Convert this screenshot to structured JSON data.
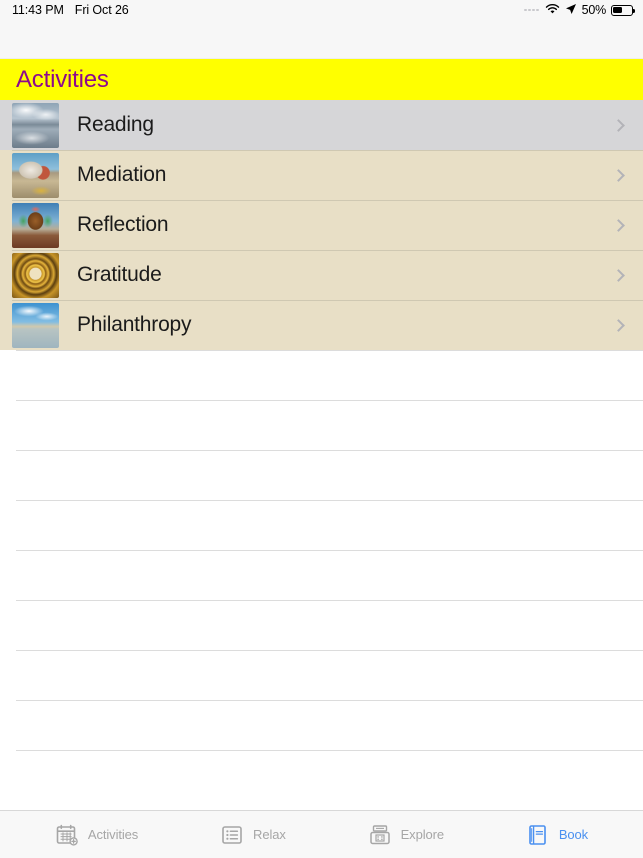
{
  "status_bar": {
    "time": "11:43 PM",
    "date": "Fri Oct 26",
    "signal_icon": "signal-dots-icon",
    "wifi_icon": "wifi-icon",
    "location_icon": "location-arrow-icon",
    "battery_percent": "50%",
    "battery_icon": "battery-icon",
    "battery_level": 50
  },
  "section": {
    "title": "Activities",
    "header_background": "#ffff00",
    "header_text_color": "#8d0a8d"
  },
  "list": {
    "background": "#e8dfc6",
    "selected_background": "#d6d6d8",
    "rows": [
      {
        "label": "Reading",
        "thumb": "lake-reflection-thumbnail",
        "art": "art-lake-reflection",
        "selected": true,
        "accessory": "chevron-right-icon"
      },
      {
        "label": "Mediation",
        "thumb": "shore-camp-thumbnail",
        "art": "art-shore-camp",
        "selected": false,
        "accessory": "chevron-right-icon"
      },
      {
        "label": "Reflection",
        "thumb": "ornate-urn-thumbnail",
        "art": "art-urn",
        "selected": false,
        "accessory": "chevron-right-icon"
      },
      {
        "label": "Gratitude",
        "thumb": "golden-mandala-thumbnail",
        "art": "art-mandala",
        "selected": false,
        "accessory": "chevron-right-icon"
      },
      {
        "label": "Philanthropy",
        "thumb": "sky-water-thumbnail",
        "art": "art-sky-water",
        "selected": false,
        "accessory": "chevron-right-icon"
      }
    ]
  },
  "empty_sheet": {
    "line_count": 9,
    "line_spacing": 50,
    "line_color": "#dcdcdc"
  },
  "tab_bar": {
    "active_color": "#4a90f0",
    "inactive_color": "#a6a6a6",
    "tabs": [
      {
        "label": "Activities",
        "icon": "calendar-add-icon",
        "active": false
      },
      {
        "label": "Relax",
        "icon": "list-bullet-icon",
        "active": false
      },
      {
        "label": "Explore",
        "icon": "scanner-box-icon",
        "active": false
      },
      {
        "label": "Book",
        "icon": "book-icon",
        "active": true
      }
    ]
  }
}
